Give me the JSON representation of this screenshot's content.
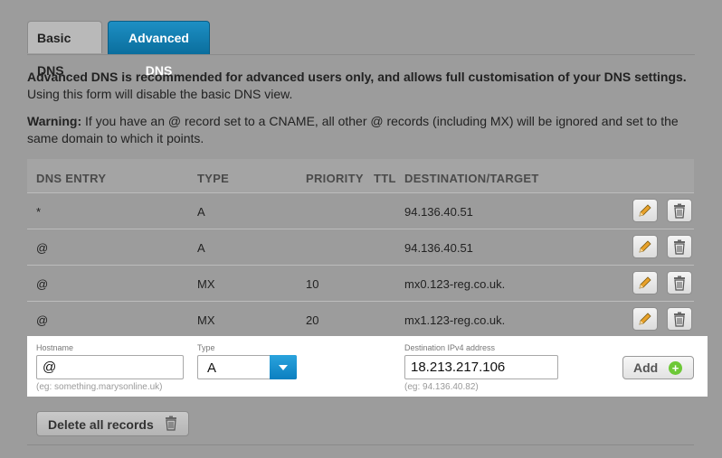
{
  "tabs": [
    {
      "label": "Basic DNS",
      "active": false
    },
    {
      "label": "Advanced DNS",
      "active": true
    }
  ],
  "intro": {
    "bold": "Advanced DNS is recommended for advanced users only, and allows full customisation of your DNS settings.",
    "text": "Using this form will disable the basic DNS view."
  },
  "warning": {
    "label": "Warning:",
    "text": " If you have an @ record set to a CNAME, all other @ records (including MX) will be ignored and set to the same domain to which it points."
  },
  "table": {
    "headers": {
      "entry": "DNS ENTRY",
      "type": "TYPE",
      "priority": "PRIORITY",
      "ttl": "TTL",
      "destination": "DESTINATION/TARGET"
    },
    "rows": [
      {
        "entry": "*",
        "type": "A",
        "priority": "",
        "ttl": "",
        "destination": "94.136.40.51"
      },
      {
        "entry": "@",
        "type": "A",
        "priority": "",
        "ttl": "",
        "destination": "94.136.40.51"
      },
      {
        "entry": "@",
        "type": "MX",
        "priority": "10",
        "ttl": "",
        "destination": "mx0.123-reg.co.uk."
      },
      {
        "entry": "@",
        "type": "MX",
        "priority": "20",
        "ttl": "",
        "destination": "mx1.123-reg.co.uk."
      }
    ]
  },
  "form": {
    "hostname_label": "Hostname",
    "hostname_value": "@",
    "hostname_hint": "(eg: something.marysonline.uk)",
    "type_label": "Type",
    "type_value": "A",
    "destination_label": "Destination IPv4 address",
    "destination_value": "18.213.217.106",
    "destination_hint": "(eg: 94.136.40.82)",
    "add_label": "Add"
  },
  "delete_all_label": "Delete all records",
  "colors": {
    "accent": "#0a7ab5",
    "add_icon": "#6dc837",
    "background": "#9c9c9c"
  },
  "icons": {
    "edit": "pencil-icon",
    "delete": "trash-icon",
    "add": "plus-circle-icon",
    "select": "chevron-down-icon"
  }
}
